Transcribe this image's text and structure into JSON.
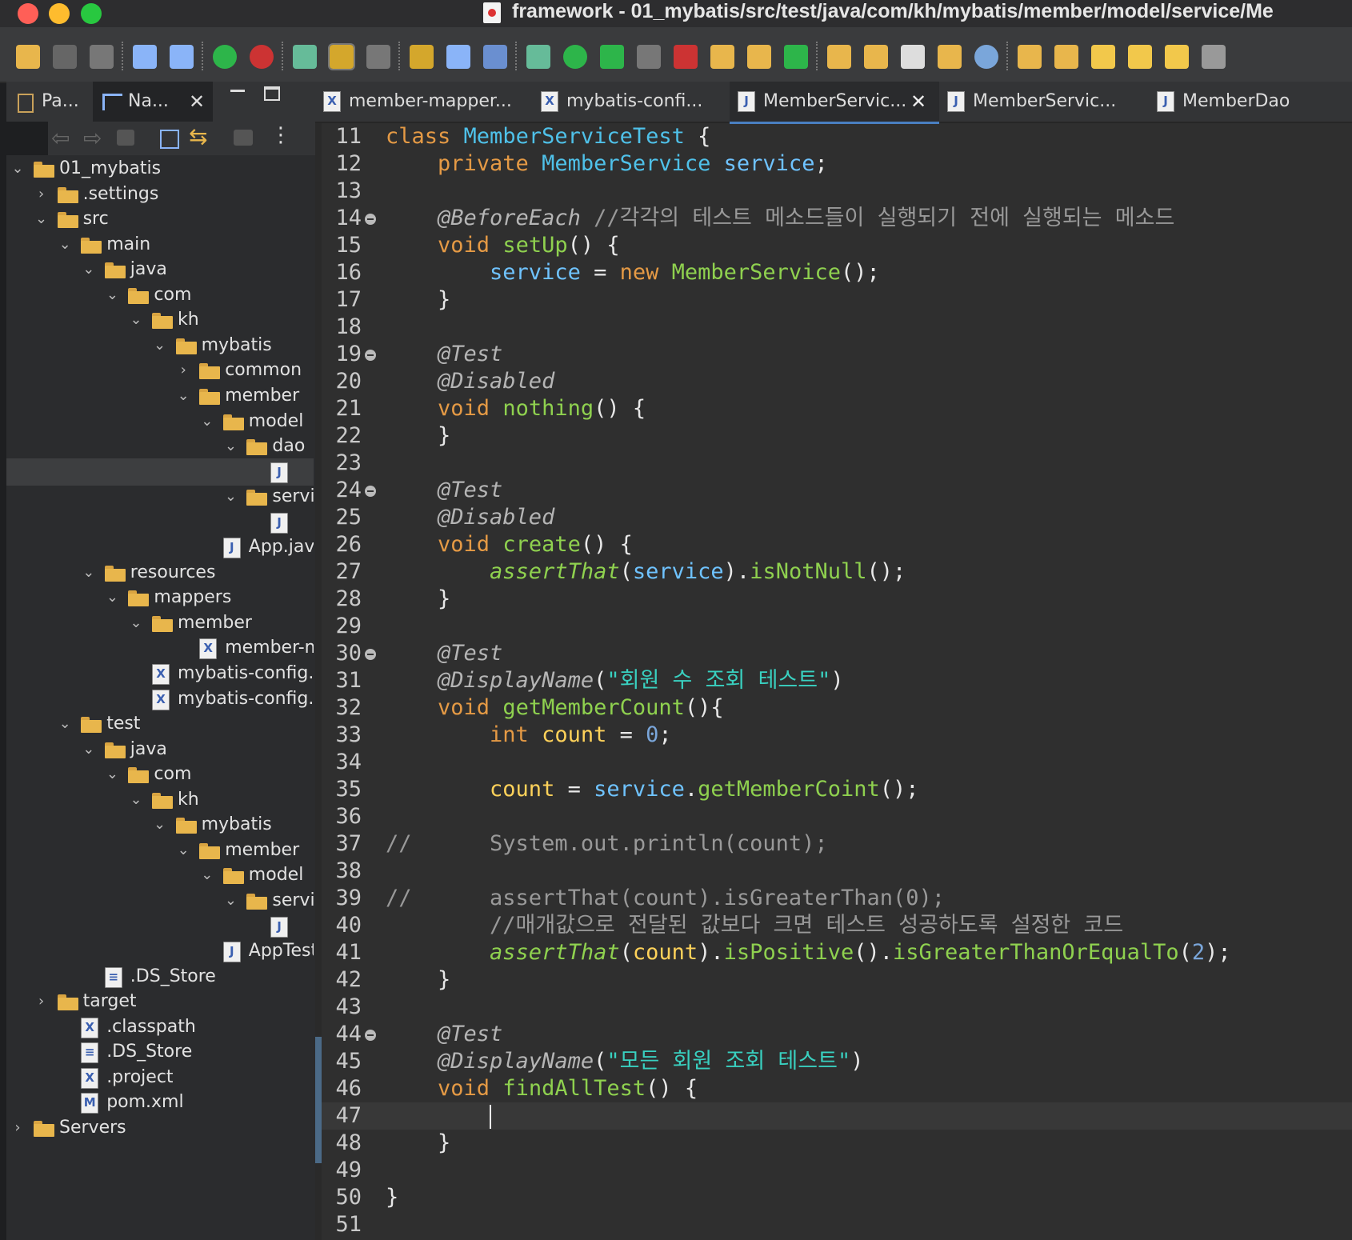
{
  "window": {
    "title": "framework - 01_mybatis/src/test/java/com/kh/mybatis/member/model/service/Me"
  },
  "toolbar": {
    "icons": [
      "new-icon",
      "save-icon",
      "save-all-icon",
      "terminal-icon",
      "search-icon",
      "power-icon",
      "update-icon",
      "build-icon",
      "highlight-icon",
      "debug-config-icon",
      "open-type-icon",
      "open-resource-icon",
      "pilcrow-icon",
      "bug-icon",
      "run-icon",
      "run-config-icon",
      "stop-icon",
      "breakpoint-icon",
      "new-class-icon",
      "new-package-icon",
      "refresh-icon",
      "open-folder-icon",
      "folder-icon",
      "wand-icon",
      "open-project-icon",
      "globe-icon",
      "download-icon",
      "upload-icon",
      "back-edit-icon",
      "forward-edit-icon",
      "back-icon",
      "forward-icon"
    ]
  },
  "left_pane": {
    "tabs": [
      {
        "label": "Pa...",
        "icon": "package-explorer-icon"
      },
      {
        "label": "Na...",
        "icon": "navigator-icon",
        "close": "✕"
      }
    ],
    "tree": [
      {
        "label": "01_mybatis",
        "depth": 0,
        "chevron": "⌄",
        "icon": "project"
      },
      {
        "label": ".settings",
        "depth": 1,
        "chevron": "›",
        "icon": "folder"
      },
      {
        "label": "src",
        "depth": 1,
        "chevron": "⌄",
        "icon": "folder"
      },
      {
        "label": "main",
        "depth": 2,
        "chevron": "⌄",
        "icon": "folder"
      },
      {
        "label": "java",
        "depth": 3,
        "chevron": "⌄",
        "icon": "folder"
      },
      {
        "label": "com",
        "depth": 4,
        "chevron": "⌄",
        "icon": "folder"
      },
      {
        "label": "kh",
        "depth": 5,
        "chevron": "⌄",
        "icon": "folder"
      },
      {
        "label": "mybatis",
        "depth": 6,
        "chevron": "⌄",
        "icon": "folder"
      },
      {
        "label": "common",
        "depth": 7,
        "chevron": "›",
        "icon": "folder"
      },
      {
        "label": "member",
        "depth": 7,
        "chevron": "⌄",
        "icon": "folder"
      },
      {
        "label": "model",
        "depth": 8,
        "chevron": "⌄",
        "icon": "folder"
      },
      {
        "label": "dao",
        "depth": 9,
        "chevron": "⌄",
        "icon": "folder"
      },
      {
        "label": "",
        "depth": 10,
        "chevron": "",
        "icon": "java",
        "selected": true
      },
      {
        "label": "service",
        "depth": 9,
        "chevron": "⌄",
        "icon": "folder"
      },
      {
        "label": "",
        "depth": 10,
        "chevron": "",
        "icon": "java"
      },
      {
        "label": "App.java",
        "depth": 8,
        "chevron": "",
        "icon": "java"
      },
      {
        "label": "resources",
        "depth": 3,
        "chevron": "⌄",
        "icon": "folder"
      },
      {
        "label": "mappers",
        "depth": 4,
        "chevron": "⌄",
        "icon": "folder"
      },
      {
        "label": "member",
        "depth": 5,
        "chevron": "⌄",
        "icon": "folder"
      },
      {
        "label": "member-m",
        "depth": 7,
        "chevron": "",
        "icon": "xml"
      },
      {
        "label": "mybatis-config.o",
        "depth": 5,
        "chevron": "",
        "icon": "xml"
      },
      {
        "label": "mybatis-config.x",
        "depth": 5,
        "chevron": "",
        "icon": "xml"
      },
      {
        "label": "test",
        "depth": 2,
        "chevron": "⌄",
        "icon": "folder"
      },
      {
        "label": "java",
        "depth": 3,
        "chevron": "⌄",
        "icon": "folder"
      },
      {
        "label": "com",
        "depth": 4,
        "chevron": "⌄",
        "icon": "folder"
      },
      {
        "label": "kh",
        "depth": 5,
        "chevron": "⌄",
        "icon": "folder"
      },
      {
        "label": "mybatis",
        "depth": 6,
        "chevron": "⌄",
        "icon": "folder"
      },
      {
        "label": "member",
        "depth": 7,
        "chevron": "⌄",
        "icon": "folder"
      },
      {
        "label": "model",
        "depth": 8,
        "chevron": "⌄",
        "icon": "folder"
      },
      {
        "label": "service",
        "depth": 9,
        "chevron": "⌄",
        "icon": "folder"
      },
      {
        "label": "",
        "depth": 10,
        "chevron": "",
        "icon": "java"
      },
      {
        "label": "AppTest",
        "depth": 8,
        "chevron": "",
        "icon": "java"
      },
      {
        "label": ".DS_Store",
        "depth": 3,
        "chevron": "",
        "icon": "doc"
      },
      {
        "label": "target",
        "depth": 1,
        "chevron": "›",
        "icon": "folder"
      },
      {
        "label": ".classpath",
        "depth": 2,
        "chevron": "",
        "icon": "xml"
      },
      {
        "label": ".DS_Store",
        "depth": 2,
        "chevron": "",
        "icon": "doc"
      },
      {
        "label": ".project",
        "depth": 2,
        "chevron": "",
        "icon": "xml"
      },
      {
        "label": "pom.xml",
        "depth": 2,
        "chevron": "",
        "icon": "maven"
      },
      {
        "label": "Servers",
        "depth": 0,
        "chevron": "›",
        "icon": "project"
      }
    ]
  },
  "editor": {
    "tabs": [
      {
        "label": "member-mapper...",
        "icon": "X"
      },
      {
        "label": "mybatis-confi...",
        "icon": "X"
      },
      {
        "label": "MemberServic...",
        "icon": "J",
        "active": true,
        "close": "✕"
      },
      {
        "label": "MemberServic...",
        "icon": "J"
      },
      {
        "label": "MemberDao",
        "icon": "J"
      }
    ],
    "current_line": 47,
    "lines": [
      {
        "n": "11",
        "tokens": [
          [
            "kw",
            "class "
          ],
          [
            "ty",
            "MemberServiceTest "
          ],
          [
            "id",
            "{"
          ]
        ]
      },
      {
        "n": "12",
        "tokens": [
          [
            "kw",
            "    private "
          ],
          [
            "ty",
            "MemberService "
          ],
          [
            "fld",
            "service"
          ],
          [
            "id",
            ";"
          ]
        ]
      },
      {
        "n": "13",
        "tokens": []
      },
      {
        "n": "14",
        "fold": true,
        "tokens": [
          [
            "ann",
            "    @BeforeEach "
          ],
          [
            "cm",
            "//각각의 테스트 메소드들이 실행되기 전에 실행되는 메소드"
          ]
        ]
      },
      {
        "n": "15",
        "tokens": [
          [
            "kw",
            "    void "
          ],
          [
            "fn",
            "setUp"
          ],
          [
            "id",
            "() {"
          ]
        ]
      },
      {
        "n": "16",
        "tokens": [
          [
            "fld",
            "        service "
          ],
          [
            "id",
            "= "
          ],
          [
            "kw",
            "new "
          ],
          [
            "fn",
            "MemberService"
          ],
          [
            "id",
            "();"
          ]
        ]
      },
      {
        "n": "17",
        "tokens": [
          [
            "id",
            "    }"
          ]
        ]
      },
      {
        "n": "18",
        "tokens": []
      },
      {
        "n": "19",
        "fold": true,
        "tokens": [
          [
            "ann",
            "    @Test"
          ]
        ]
      },
      {
        "n": "20",
        "tokens": [
          [
            "ann",
            "    @Disabled"
          ]
        ]
      },
      {
        "n": "21",
        "tokens": [
          [
            "kw",
            "    void "
          ],
          [
            "fn",
            "nothing"
          ],
          [
            "id",
            "() {"
          ]
        ]
      },
      {
        "n": "22",
        "tokens": [
          [
            "id",
            "    }"
          ]
        ]
      },
      {
        "n": "23",
        "tokens": []
      },
      {
        "n": "24",
        "fold": true,
        "tokens": [
          [
            "ann",
            "    @Test"
          ]
        ]
      },
      {
        "n": "25",
        "tokens": [
          [
            "ann",
            "    @Disabled"
          ]
        ]
      },
      {
        "n": "26",
        "tokens": [
          [
            "kw",
            "    void "
          ],
          [
            "fn",
            "create"
          ],
          [
            "id",
            "() {"
          ]
        ]
      },
      {
        "n": "27",
        "tokens": [
          [
            "st",
            "        assertThat"
          ],
          [
            "id",
            "("
          ],
          [
            "fld",
            "service"
          ],
          [
            "id",
            ")."
          ],
          [
            "fn",
            "isNotNull"
          ],
          [
            "id",
            "();"
          ]
        ]
      },
      {
        "n": "28",
        "tokens": [
          [
            "id",
            "    }"
          ]
        ]
      },
      {
        "n": "29",
        "tokens": []
      },
      {
        "n": "30",
        "fold": true,
        "tokens": [
          [
            "ann",
            "    @Test"
          ]
        ]
      },
      {
        "n": "31",
        "tokens": [
          [
            "ann",
            "    @DisplayName"
          ],
          [
            "id",
            "("
          ],
          [
            "str",
            "\"회원 수 조회 테스트\""
          ],
          [
            "id",
            ")"
          ]
        ]
      },
      {
        "n": "32",
        "tokens": [
          [
            "kw",
            "    void "
          ],
          [
            "fn",
            "getMemberCount"
          ],
          [
            "id",
            "(){"
          ]
        ]
      },
      {
        "n": "33",
        "tokens": [
          [
            "kw",
            "        int "
          ],
          [
            "var",
            "count "
          ],
          [
            "id",
            "= "
          ],
          [
            "num",
            "0"
          ],
          [
            "id",
            ";"
          ]
        ]
      },
      {
        "n": "34",
        "tokens": []
      },
      {
        "n": "35",
        "tokens": [
          [
            "var",
            "        count "
          ],
          [
            "id",
            "= "
          ],
          [
            "fld",
            "service"
          ],
          [
            "id",
            "."
          ],
          [
            "fn",
            "getMemberCoint"
          ],
          [
            "id",
            "();"
          ]
        ]
      },
      {
        "n": "36",
        "tokens": []
      },
      {
        "n": "37",
        "tokens": [
          [
            "cm",
            "//      System.out.println(count);"
          ]
        ]
      },
      {
        "n": "38",
        "tokens": []
      },
      {
        "n": "39",
        "tokens": [
          [
            "cm",
            "//      assertThat(count).isGreaterThan(0);"
          ]
        ]
      },
      {
        "n": "40",
        "tokens": [
          [
            "cm",
            "        //매개값으로 전달된 값보다 크면 테스트 성공하도록 설정한 코드"
          ]
        ]
      },
      {
        "n": "41",
        "tokens": [
          [
            "st",
            "        assertThat"
          ],
          [
            "id",
            "("
          ],
          [
            "var",
            "count"
          ],
          [
            "id",
            ")."
          ],
          [
            "fn",
            "isPositive"
          ],
          [
            "id",
            "()."
          ],
          [
            "fn",
            "isGreaterThanOrEqualTo"
          ],
          [
            "id",
            "("
          ],
          [
            "num",
            "2"
          ],
          [
            "id",
            ");"
          ]
        ]
      },
      {
        "n": "42",
        "tokens": [
          [
            "id",
            "    }"
          ]
        ]
      },
      {
        "n": "43",
        "tokens": []
      },
      {
        "n": "44",
        "fold": true,
        "tokens": [
          [
            "ann",
            "    @Test"
          ]
        ]
      },
      {
        "n": "45",
        "tokens": [
          [
            "ann",
            "    @DisplayName"
          ],
          [
            "id",
            "("
          ],
          [
            "str",
            "\"모든 회원 조회 테스트\""
          ],
          [
            "id",
            ")"
          ]
        ]
      },
      {
        "n": "46",
        "tokens": [
          [
            "kw",
            "    void "
          ],
          [
            "fn",
            "findAllTest"
          ],
          [
            "id",
            "() {"
          ]
        ]
      },
      {
        "n": "47",
        "tokens": [
          [
            "id",
            "        "
          ]
        ],
        "caret": true
      },
      {
        "n": "48",
        "tokens": [
          [
            "id",
            "    }"
          ]
        ]
      },
      {
        "n": "49",
        "tokens": []
      },
      {
        "n": "50",
        "tokens": [
          [
            "id",
            "}"
          ]
        ]
      },
      {
        "n": "51",
        "tokens": []
      }
    ]
  },
  "colors": {
    "keyword": "#e59a45",
    "type": "#4fc1e9",
    "method": "#8fd14f",
    "string": "#39d0c0",
    "annotation": "#b5b5b5",
    "comment": "#999999",
    "local_var": "#ffd25a",
    "selection": "#4a7fc1"
  }
}
